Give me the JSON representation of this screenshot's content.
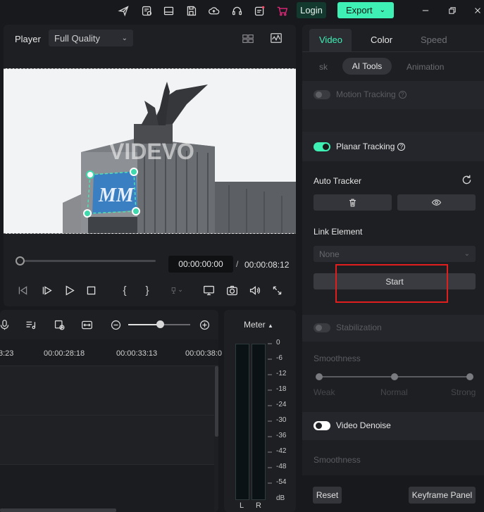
{
  "topbar": {
    "login_label": "Login",
    "export_label": "Export"
  },
  "player": {
    "label": "Player",
    "quality": "Full Quality",
    "current_time": "00:00:00:00",
    "separator": "/",
    "total_time": "00:00:08:12",
    "watermark": "VIDEVO",
    "sign_text": "MM"
  },
  "timeline": {
    "ruler_labels": [
      "3:23",
      "00:00:28:18",
      "00:00:33:13",
      "00:00:38:0"
    ]
  },
  "meter": {
    "title": "Meter",
    "ticks": [
      "0",
      "-6",
      "-12",
      "-18",
      "-24",
      "-30",
      "-36",
      "-42",
      "-48",
      "-54",
      "dB"
    ],
    "left_label": "L",
    "right_label": "R"
  },
  "right_panel": {
    "tabs": [
      "Video",
      "Color",
      "Speed"
    ],
    "active_tab": "Video",
    "subtabs": [
      "sk",
      "AI Tools",
      "Animation"
    ],
    "active_subtab": "AI Tools",
    "motion_tracking": "Motion Tracking",
    "planar_tracking": "Planar Tracking",
    "auto_tracker": "Auto Tracker",
    "link_element": "Link Element",
    "link_value": "None",
    "start_label": "Start",
    "stabilization": "Stabilization",
    "smoothness_1": "Smoothness",
    "slider_labels": [
      "Weak",
      "Normal",
      "Strong"
    ],
    "video_denoise": "Video Denoise",
    "smoothness_2": "Smoothness",
    "reset_label": "Reset",
    "keyframe_label": "Keyframe Panel"
  },
  "colors": {
    "accent": "#3ef0b4",
    "highlight": "#e01e1e"
  }
}
